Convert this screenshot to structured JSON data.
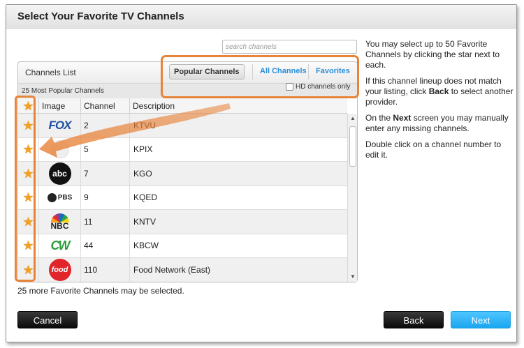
{
  "dialog": {
    "title": "Select Your Favorite TV Channels"
  },
  "search": {
    "placeholder": "search channels",
    "value": ""
  },
  "panel": {
    "title": "Channels List",
    "subheading": "25 Most Popular Channels",
    "tabs": {
      "popular": "Popular Channels",
      "all": "All Channels",
      "favorites": "Favorites"
    },
    "hd_only_label": "HD channels only",
    "hd_only_checked": false
  },
  "table": {
    "columns": {
      "image": "Image",
      "channel": "Channel",
      "description": "Description"
    },
    "rows": [
      {
        "logo": "fox-logo",
        "logo_text": "FOX",
        "channel": "2",
        "description": "KTVU",
        "favorite": true
      },
      {
        "logo": "cbs-logo",
        "logo_text": "",
        "channel": "5",
        "description": "KPIX",
        "favorite": true
      },
      {
        "logo": "abc-logo",
        "logo_text": "abc",
        "channel": "7",
        "description": "KGO",
        "favorite": true
      },
      {
        "logo": "pbs-logo",
        "logo_text": "PBS",
        "channel": "9",
        "description": "KQED",
        "favorite": true
      },
      {
        "logo": "nbc-logo",
        "logo_text": "NBC",
        "channel": "11",
        "description": "KNTV",
        "favorite": true
      },
      {
        "logo": "cw-logo",
        "logo_text": "CW",
        "channel": "44",
        "description": "KBCW",
        "favorite": true
      },
      {
        "logo": "food-network-logo",
        "logo_text": "food",
        "channel": "110",
        "description": "Food Network (East)",
        "favorite": true
      }
    ]
  },
  "footer_note": "25 more Favorite Channels may be selected.",
  "help": {
    "p1": "You may select up to 50 Favorite Channels by clicking the star next to each.",
    "p2_pre": "If this channel lineup does not match your listing, click ",
    "p2_bold": "Back",
    "p2_post": " to select another provider.",
    "p3_pre": "On the ",
    "p3_bold": "Next",
    "p3_post": " screen you may manually enter any missing channels.",
    "p4": "Double click on a channel number to edit it."
  },
  "buttons": {
    "cancel": "Cancel",
    "back": "Back",
    "next": "Next"
  },
  "colors": {
    "accent_orange": "#e8833a",
    "link_blue": "#2a8fd6",
    "next_blue": "#1aa6f0",
    "star": "#f2a020"
  }
}
